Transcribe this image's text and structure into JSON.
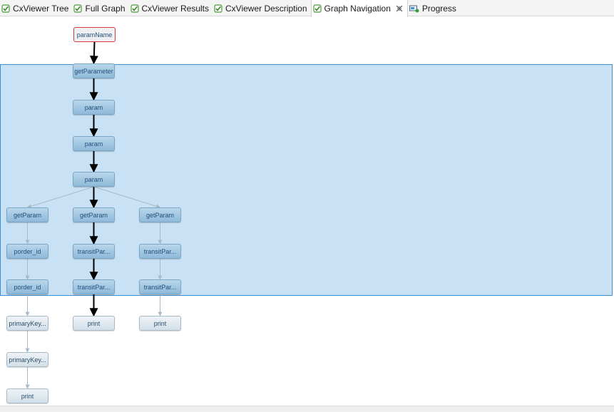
{
  "tabs": [
    {
      "label": "CxViewer Tree",
      "icon": "check-icon"
    },
    {
      "label": "Full Graph",
      "icon": "check-icon"
    },
    {
      "label": "CxViewer Results",
      "icon": "check-icon"
    },
    {
      "label": "CxViewer Description",
      "icon": "check-icon"
    },
    {
      "label": "Graph Navigation",
      "icon": "check-icon",
      "active": true
    },
    {
      "label": "Progress",
      "icon": "progress-icon"
    }
  ],
  "colors": {
    "selection_fill": "#c8e1f4",
    "selection_border": "#3c8fd2",
    "start_border": "#d43a3a",
    "edge_strong": "#000000",
    "edge_weak": "#a9b9c6"
  },
  "graph": {
    "nodes": {
      "n0": "paramName",
      "n1": "getParameter",
      "n2": "param",
      "n3": "param",
      "n4": "param",
      "l1": "getParam",
      "m1": "getParam",
      "r1": "getParam",
      "l2": "porder_id",
      "m2": "transitPar...",
      "r2": "transitPar...",
      "l3": "porder_id",
      "m3": "transitPar...",
      "r3": "transitPar...",
      "l4": "primaryKey...",
      "m4": "print",
      "r4": "print",
      "l5": "primaryKey...",
      "l6": "print"
    }
  }
}
